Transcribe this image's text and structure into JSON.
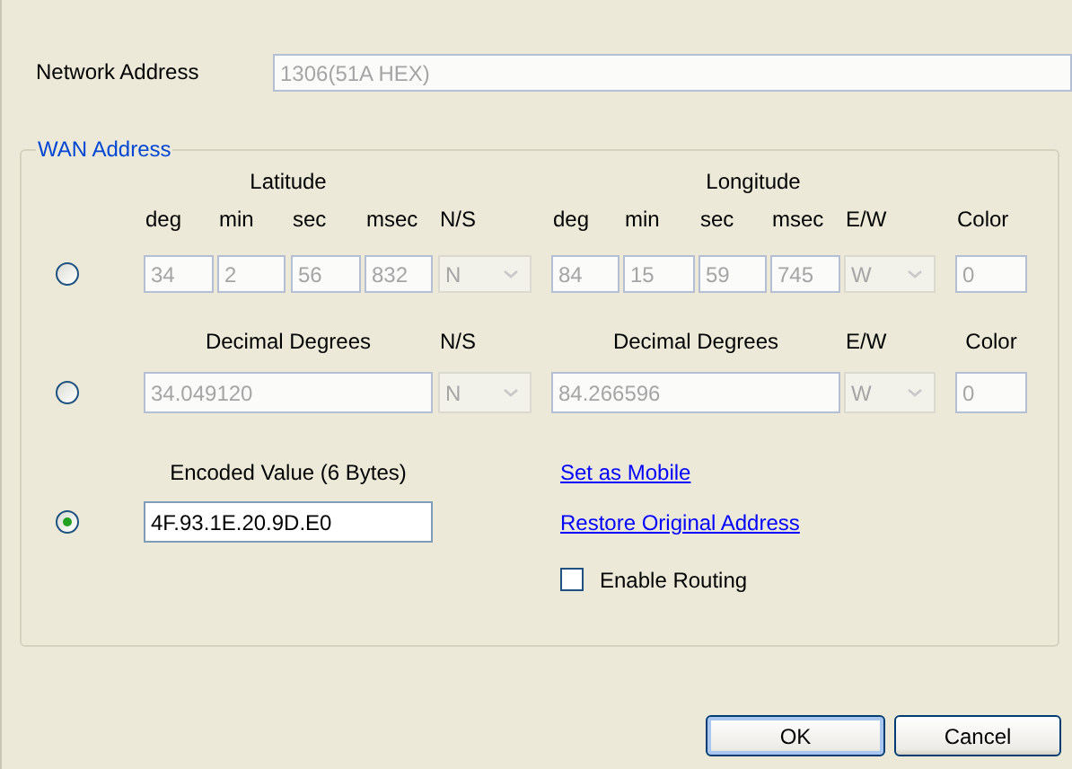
{
  "network_address": {
    "label": "Network Address",
    "value": "1306(51A HEX)",
    "disabled": true
  },
  "wan_address": {
    "title": "WAN Address",
    "modes": [
      {
        "kind": "dms",
        "selected": false,
        "headers": [
          "Latitude",
          "Longitude"
        ],
        "fields": [
          {
            "kind": "text",
            "label": "deg",
            "value": "34",
            "disabled": true
          },
          {
            "kind": "text",
            "label": "min",
            "value": "2",
            "disabled": true
          },
          {
            "kind": "text",
            "label": "sec",
            "value": "56",
            "disabled": true
          },
          {
            "kind": "text",
            "label": "msec",
            "value": "832",
            "disabled": true
          },
          {
            "kind": "select",
            "label": "N/S",
            "value": "N",
            "disabled": true
          },
          {
            "kind": "text",
            "label": "deg",
            "value": "84",
            "disabled": true
          },
          {
            "kind": "text",
            "label": "min",
            "value": "15",
            "disabled": true
          },
          {
            "kind": "text",
            "label": "sec",
            "value": "59",
            "disabled": true
          },
          {
            "kind": "text",
            "label": "msec",
            "value": "745",
            "disabled": true
          },
          {
            "kind": "select",
            "label": "E/W",
            "value": "W",
            "disabled": true
          },
          {
            "kind": "text",
            "label": "Color",
            "value": "0",
            "disabled": true
          }
        ]
      },
      {
        "kind": "decimal",
        "selected": false,
        "fields": [
          {
            "kind": "text",
            "label": "Decimal Degrees",
            "value": "34.049120",
            "disabled": true
          },
          {
            "kind": "select",
            "label": "N/S",
            "value": "N",
            "disabled": true
          },
          {
            "kind": "text",
            "label": "Decimal Degrees",
            "value": "84.266596",
            "disabled": true
          },
          {
            "kind": "select",
            "label": "E/W",
            "value": "W",
            "disabled": true
          },
          {
            "kind": "text",
            "label": "Color",
            "value": "0",
            "disabled": true
          }
        ]
      },
      {
        "kind": "encoded",
        "selected": true,
        "fields": [
          {
            "kind": "text",
            "label": "Encoded Value (6 Bytes)",
            "value": "4F.93.1E.20.9D.E0",
            "disabled": false
          }
        ]
      }
    ],
    "links": [
      "Set as Mobile",
      "Restore Original Address"
    ],
    "routing": {
      "label": "Enable Routing",
      "checked": false
    }
  },
  "buttons": [
    {
      "label": "OK",
      "default": true
    },
    {
      "label": "Cancel",
      "default": false
    }
  ]
}
